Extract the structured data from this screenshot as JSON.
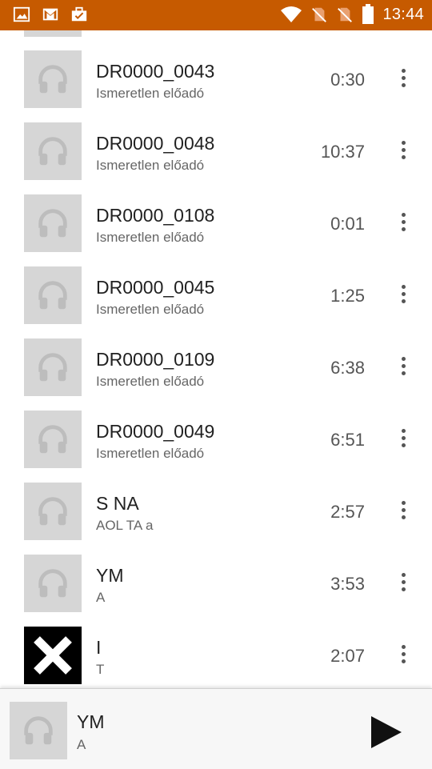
{
  "status_bar": {
    "time": "13:44",
    "icons": [
      "image-icon",
      "gmail-icon",
      "briefcase-icon",
      "wifi-icon",
      "no-sim-icon",
      "no-sim-icon",
      "battery-icon"
    ]
  },
  "songs": [
    {
      "title": "DR0000_0043",
      "artist": "Ismeretlen előadó",
      "duration": "0:30",
      "art": "headphones-placeholder"
    },
    {
      "title": "DR0000_0048",
      "artist": "Ismeretlen előadó",
      "duration": "10:37",
      "art": "headphones-placeholder"
    },
    {
      "title": "DR0000_0108",
      "artist": "Ismeretlen előadó",
      "duration": "0:01",
      "art": "headphones-placeholder"
    },
    {
      "title": "DR0000_0045",
      "artist": "Ismeretlen előadó",
      "duration": "1:25",
      "art": "headphones-placeholder"
    },
    {
      "title": "DR0000_0109",
      "artist": "Ismeretlen előadó",
      "duration": "6:38",
      "art": "headphones-placeholder"
    },
    {
      "title": "DR0000_0049",
      "artist": "Ismeretlen előadó",
      "duration": "6:51",
      "art": "headphones-placeholder"
    },
    {
      "title": "S  NA",
      "artist": "AOL TA a",
      "duration": "2:57",
      "art": "headphones-placeholder"
    },
    {
      "title": "YM",
      "artist": "A",
      "duration": "3:53",
      "art": "headphones-placeholder"
    },
    {
      "title": "I",
      "artist": "T",
      "duration": "2:07",
      "art": "x-album-art"
    }
  ],
  "now_playing": {
    "title": "YM",
    "artist": "A",
    "control": "play-icon"
  },
  "colors": {
    "status_bar": "#c65a00",
    "art_placeholder": "#d6d6d6",
    "headphones": "#bdbdbd"
  }
}
